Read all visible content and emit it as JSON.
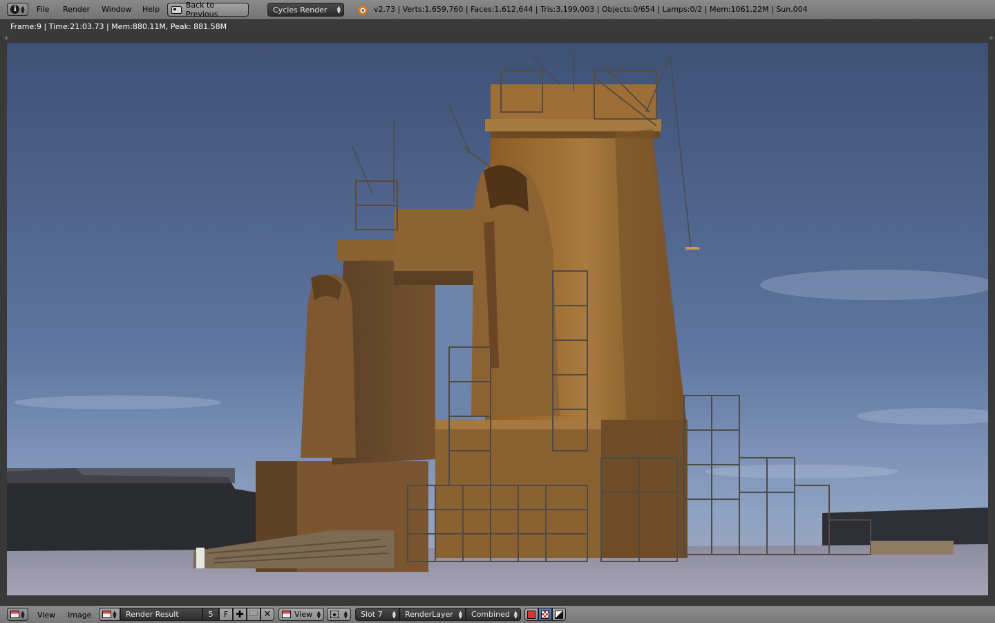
{
  "header": {
    "menus": [
      "File",
      "Render",
      "Window",
      "Help"
    ],
    "back_button": "Back to Previous",
    "render_engine": "Cycles Render",
    "stats": "v2.73 | Verts:1,659,760 | Faces:1,612,644 | Tris:3,199,003 | Objects:0/654 | Lamps:0/2 | Mem:1061.22M | Sun.004"
  },
  "render_info": "Frame:9 | Time:21:03.73 | Mem:880.11M, Peak: 881.58M",
  "footer": {
    "menus": [
      "View",
      "Image"
    ],
    "image_name": "Render Result",
    "users_count": "5",
    "fake_user": "F",
    "view_menu": "View",
    "slot": "Slot 7",
    "render_layer": "RenderLayer",
    "pass": "Combined"
  },
  "icons": {
    "editor_info": "info-icon",
    "editor_image": "image-editor-icon",
    "screen": "screen-icon",
    "engine": "blender-logo-icon"
  },
  "colors": {
    "header_bg": "#808080",
    "sky_top": "#3f5276",
    "sky_bottom": "#7d93b8",
    "stone": "#9c6e34"
  }
}
